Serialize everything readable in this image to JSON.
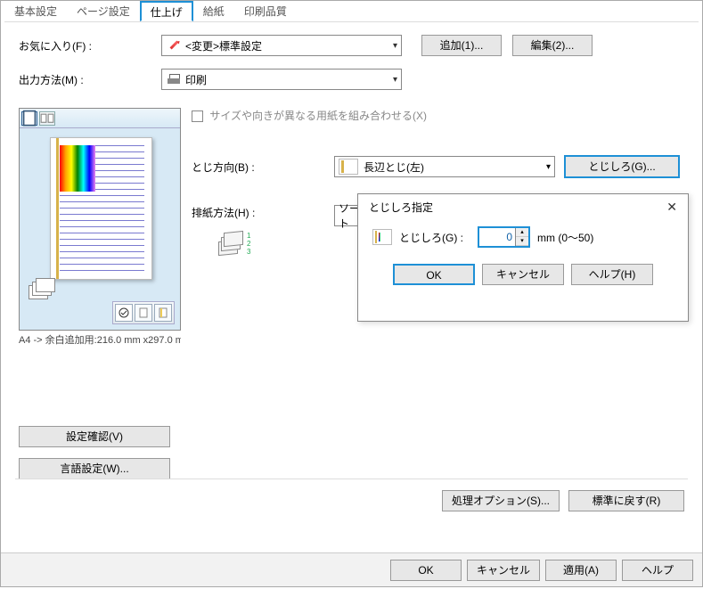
{
  "tabs": [
    "基本設定",
    "ページ設定",
    "仕上げ",
    "給紙",
    "印刷品質"
  ],
  "active_tab_index": 2,
  "favorite": {
    "label": "お気に入り(F) :",
    "value": "<変更>標準設定",
    "add_btn": "追加(1)...",
    "edit_btn": "編集(2)..."
  },
  "output": {
    "label": "出力方法(M) :",
    "value": "印刷"
  },
  "preview": {
    "caption": "A4 -> 余白追加用:216.0 mm x297.0 m"
  },
  "mix_sizes": {
    "label": "サイズや向きが異なる用紙を組み合わせる(X)",
    "checked": false
  },
  "binding": {
    "label": "とじ方向(B) :",
    "value": "長辺とじ(左)",
    "gutter_btn": "とじしろ(G)..."
  },
  "output_method": {
    "label": "排紙方法(H) :",
    "value_stub": "ソート"
  },
  "popup": {
    "title": "とじしろ指定",
    "field_label": "とじしろ(G) :",
    "value": "0",
    "unit": "mm (0～50)",
    "ok": "OK",
    "cancel": "キャンセル",
    "help": "ヘルプ(H)"
  },
  "side_buttons": {
    "confirm": "設定確認(V)",
    "language": "言語設定(W)..."
  },
  "footer1": {
    "options": "処理オプション(S)...",
    "restore": "標準に戻す(R)"
  },
  "footer2": {
    "ok": "OK",
    "cancel": "キャンセル",
    "apply": "適用(A)",
    "help": "ヘルプ"
  }
}
